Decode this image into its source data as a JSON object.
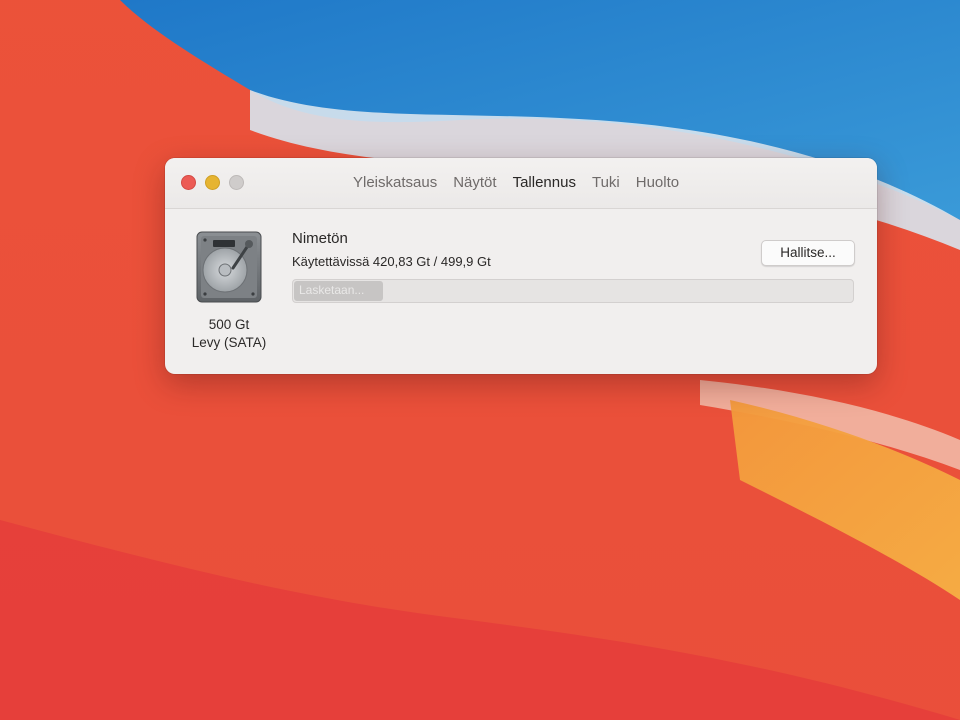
{
  "window": {
    "tabs": [
      {
        "label": "Yleiskatsaus",
        "active": false
      },
      {
        "label": "Näytöt",
        "active": false
      },
      {
        "label": "Tallennus",
        "active": true
      },
      {
        "label": "Tuki",
        "active": false
      },
      {
        "label": "Huolto",
        "active": false
      }
    ]
  },
  "drive": {
    "icon": "hard-drive-icon",
    "capacity": "500 Gt",
    "type": "Levy (SATA)"
  },
  "volume": {
    "name": "Nimetön",
    "available": "Käytettävissä 420,83 Gt / 499,9 Gt",
    "status_label": "Lasketaan...",
    "status_progress_fraction": 0.16
  },
  "buttons": {
    "manage": "Hallitse..."
  },
  "colors": {
    "close": "#ec5b55",
    "minimize": "#e6b431",
    "maximize": "#cfcccb",
    "window_bg": "#f1efee"
  }
}
